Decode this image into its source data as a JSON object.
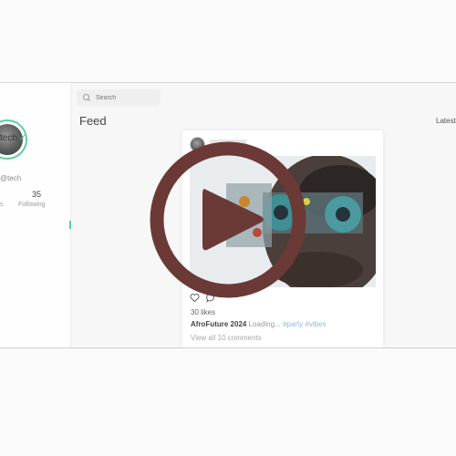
{
  "profile": {
    "name": "tech",
    "handle": "@tech",
    "stats": [
      {
        "count": "",
        "label": "s"
      },
      {
        "count": "35",
        "label": "Following"
      }
    ]
  },
  "search": {
    "placeholder": "Search"
  },
  "feed": {
    "title": "Feed",
    "filter_label": "Latest"
  },
  "post": {
    "likes": "30 likes",
    "author": "AfroFuture 2024",
    "text": "Loading...",
    "hashtags": [
      "#party",
      "#vibes"
    ],
    "comments_link": "View all 10 comments"
  },
  "overlay": {
    "icon": "play-icon",
    "color": "#6b3a36"
  },
  "colors": {
    "accent": "#5ad0a0",
    "hashtag": "#8db6e6"
  }
}
